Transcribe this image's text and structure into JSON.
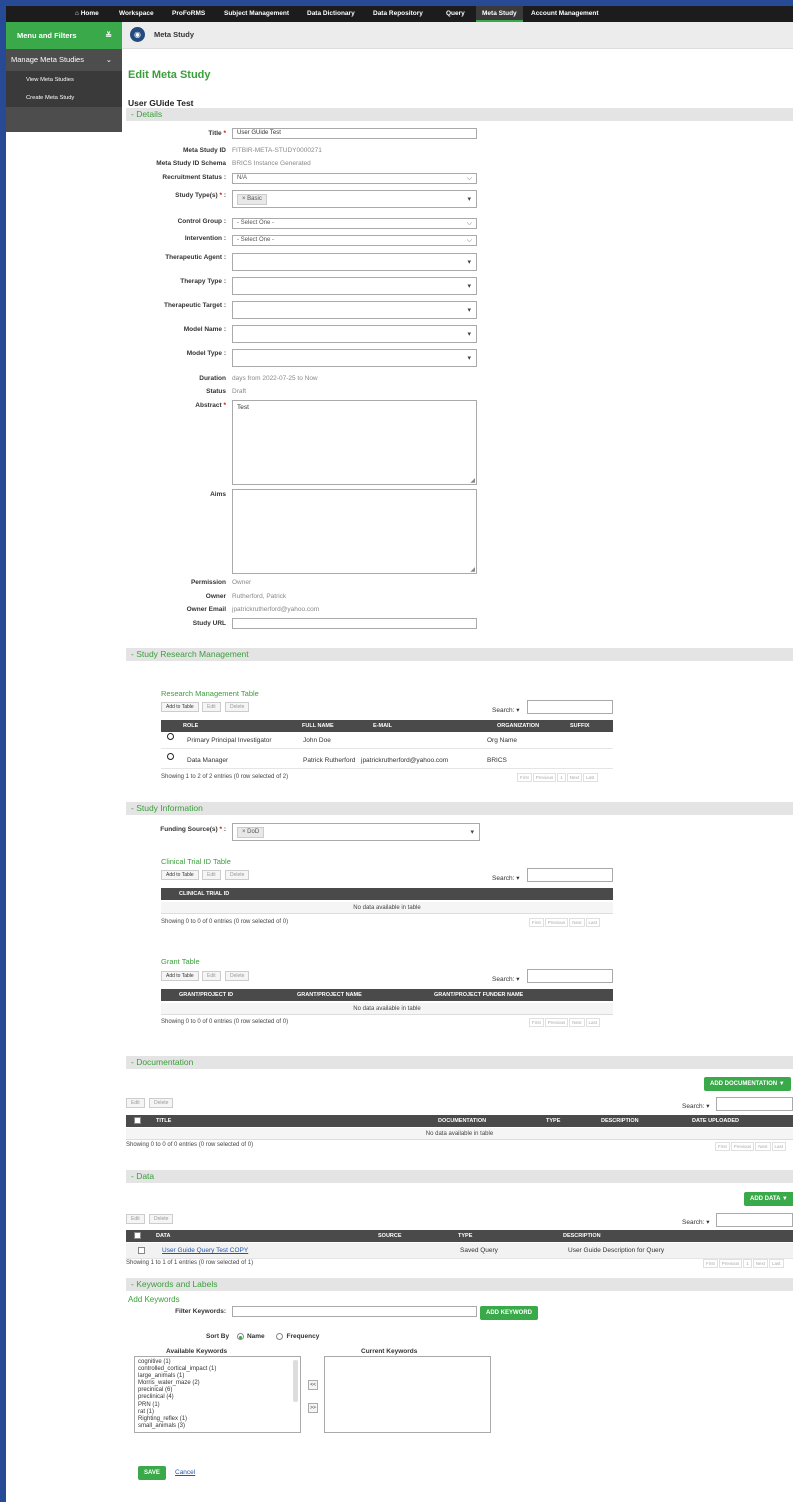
{
  "nav": {
    "home": "Home",
    "items": [
      "Workspace",
      "ProFoRMS",
      "Subject Management",
      "Data Dictionary",
      "Data Repository",
      "Query",
      "Meta Study",
      "Account Management"
    ],
    "active_index": 6
  },
  "sidebar": {
    "header": "Menu and Filters",
    "section": "Manage Meta Studies",
    "links": [
      "View Meta Studies",
      "Create Meta Study"
    ]
  },
  "breadcrumb": {
    "title": "Meta Study"
  },
  "page": {
    "title": "Edit Meta Study",
    "study_name": "User GUide Test"
  },
  "sections": {
    "details": "- Details",
    "research": "- Study Research Management",
    "info": "- Study Information",
    "documentation": "- Documentation",
    "data": "- Data",
    "keywords": "- Keywords and Labels"
  },
  "details": {
    "title_label": "Title",
    "title_value": "User GUide Test",
    "id_label": "Meta Study ID",
    "id_value": "FITBIR-META-STUDY0000271",
    "schema_label": "Meta Study ID Schema",
    "schema_value": "BRICS Instance Generated",
    "recruitment_label": "Recruitment Status :",
    "recruitment_value": "N/A",
    "study_type_label": "Study Type(s)",
    "study_type_tag": "× Basic",
    "control_label": "Control Group :",
    "control_value": "- Select One -",
    "intervention_label": "Intervention :",
    "intervention_value": "- Select One -",
    "agent_label": "Therapeutic Agent :",
    "therapy_label": "Therapy Type :",
    "target_label": "Therapeutic Target :",
    "model_name_label": "Model Name :",
    "model_type_label": "Model Type :",
    "duration_label": "Duration",
    "duration_value": "days from 2022-07-25 to Now",
    "status_label": "Status",
    "status_value": "Draft",
    "abstract_label": "Abstract",
    "abstract_value": "Test",
    "aims_label": "Aims",
    "permission_label": "Permission",
    "permission_value": "Owner",
    "owner_label": "Owner",
    "owner_value": "Rutherford, Patrick",
    "email_label": "Owner Email",
    "email_value": "jpatrickrutherford@yahoo.com",
    "url_label": "Study URL"
  },
  "common": {
    "add_to_table": "Add to Table",
    "edit": "Edit",
    "delete": "Delete",
    "search": "Search:",
    "no_data": "No data available in table"
  },
  "research_table": {
    "title": "Research Management Table",
    "columns": [
      "ROLE",
      "FULL NAME",
      "E-MAIL",
      "ORGANIZATION",
      "SUFFIX"
    ],
    "rows": [
      [
        "Primary Principal Investigator",
        "John Doe",
        "",
        "Org Name",
        ""
      ],
      [
        "Data Manager",
        "Patrick Rutherford",
        "jpatrickrutherford@yahoo.com",
        "BRICS",
        ""
      ]
    ],
    "info": "Showing 1 to 2 of 2 entries (0 row selected of 2)",
    "pager": [
      "First",
      "Previous",
      "1",
      "Next",
      "Last"
    ]
  },
  "study_info": {
    "funding_label": "Funding Source(s)",
    "funding_tag": "× DoD"
  },
  "clinical_table": {
    "title": "Clinical Trial ID Table",
    "columns": [
      "CLINICAL TRIAL ID"
    ],
    "info": "Showing 0 to 0 of 0 entries (0 row selected of 0)",
    "pager": [
      "First",
      "Previous",
      "Next",
      "Last"
    ]
  },
  "grant_table": {
    "title": "Grant Table",
    "columns": [
      "GRANT/PROJECT ID",
      "GRANT/PROJECT NAME",
      "GRANT/PROJECT FUNDER NAME"
    ],
    "info": "Showing 0 to 0 of 0 entries (0 row selected of 0)",
    "pager": [
      "First",
      "Previous",
      "Next",
      "Last"
    ]
  },
  "documentation": {
    "add_button": "ADD DOCUMENTATION ▼",
    "columns": [
      "TITLE",
      "DOCUMENTATION",
      "TYPE",
      "DESCRIPTION",
      "DATE UPLOADED"
    ],
    "info": "Showing 0 to 0 of 0 entries (0 row selected of 0)",
    "pager": [
      "First",
      "Previous",
      "Next",
      "Last"
    ]
  },
  "data_section": {
    "add_button": "ADD DATA ▼",
    "columns": [
      "DATA",
      "SOURCE",
      "TYPE",
      "DESCRIPTION"
    ],
    "rows": [
      [
        "User Guide Query Test COPY",
        "",
        "Saved Query",
        "User Guide Description for Query"
      ]
    ],
    "info": "Showing 1 to 1 of 1 entries (0 row selected of 1)",
    "pager": [
      "First",
      "Previous",
      "1",
      "Next",
      "Last"
    ]
  },
  "keywords": {
    "title": "Add Keywords",
    "filter_label": "Filter Keywords:",
    "add_button": "ADD KEYWORD",
    "sort_label": "Sort By",
    "sort_name": "Name",
    "sort_freq": "Frequency",
    "available_label": "Available Keywords",
    "current_label": "Current Keywords",
    "available": [
      "cognitive (1)",
      "controlled_cortical_impact (1)",
      "large_animals (1)",
      "Morris_water_maze (2)",
      "precinical (6)",
      "preclinical (4)",
      "PRN (1)",
      "rat (1)",
      "Righting_reflex (1)",
      "small_animals (3)"
    ],
    "move_left": "<<",
    "move_right": ">>"
  },
  "footer": {
    "save": "SAVE",
    "cancel": "Cancel"
  }
}
